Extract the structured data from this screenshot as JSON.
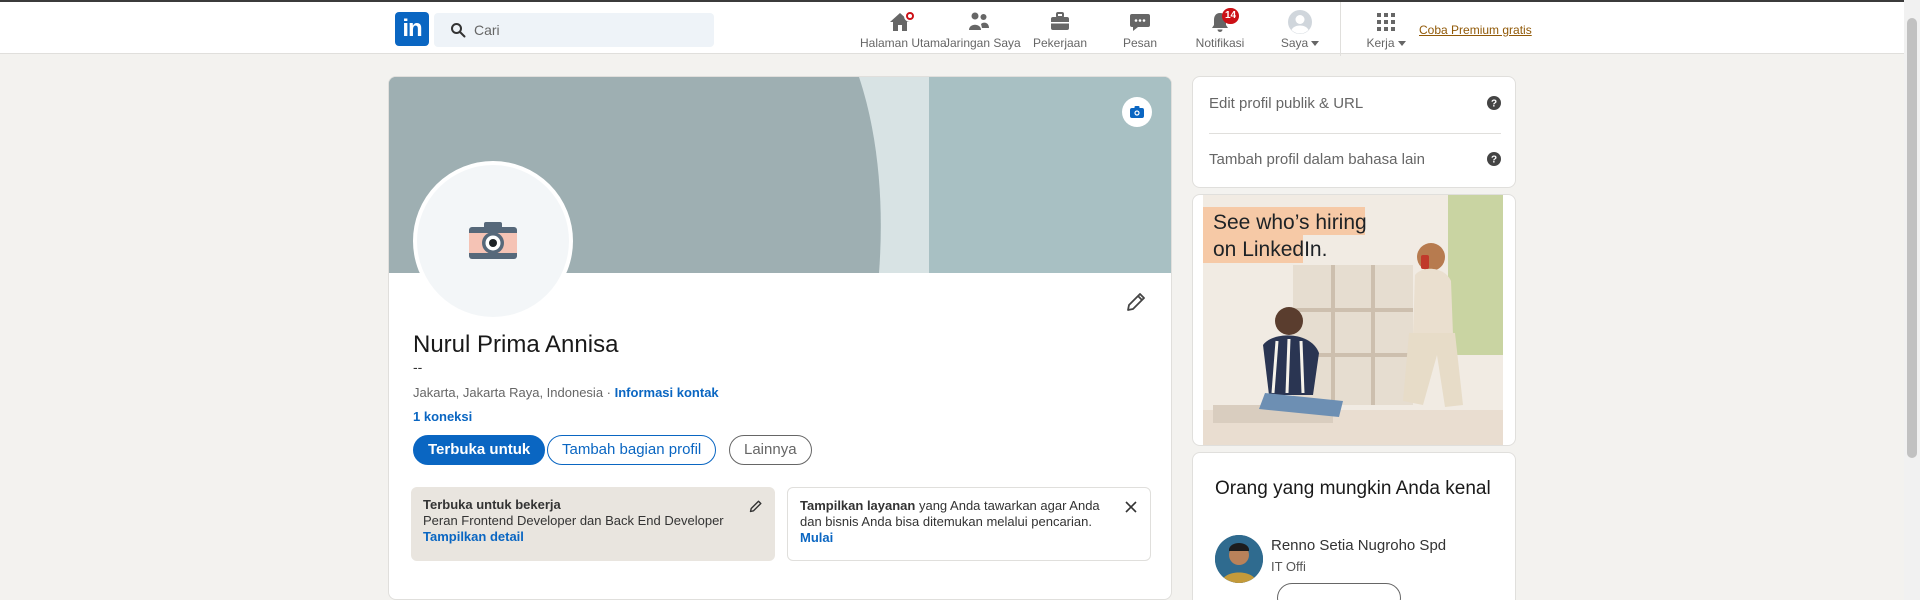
{
  "nav": {
    "logo_text": "in",
    "search_placeholder": "Cari",
    "items": [
      {
        "label": "Halaman Utama",
        "icon": "home-icon"
      },
      {
        "label": "Jaringan Saya",
        "icon": "network-icon"
      },
      {
        "label": "Pekerjaan",
        "icon": "briefcase-icon"
      },
      {
        "label": "Pesan",
        "icon": "messaging-icon"
      },
      {
        "label": "Notifikasi",
        "icon": "bell-icon",
        "badge": "14"
      },
      {
        "label": "Saya",
        "icon": "avatar-icon"
      },
      {
        "label": "Kerja",
        "icon": "grid-icon"
      }
    ],
    "premium_link": "Coba Premium gratis"
  },
  "profile": {
    "name": "Nurul Prima Annisa",
    "headline": "--",
    "location": "Jakarta, Jakarta Raya, Indonesia",
    "separator": " · ",
    "contact_link": "Informasi kontak",
    "connections": "1 koneksi",
    "buttons": {
      "open_to": "Terbuka untuk",
      "add_section": "Tambah bagian profil",
      "more": "Lainnya"
    },
    "open_to_work": {
      "title": "Terbuka untuk bekerja",
      "roles": "Peran Frontend Developer dan Back End Developer",
      "link": "Tampilkan detail"
    },
    "services": {
      "bold": "Tampilkan layanan",
      "text": " yang Anda tawarkan agar Anda dan bisnis Anda bisa ditemukan melalui pencarian.",
      "link": "Mulai"
    }
  },
  "rail": {
    "links": [
      "Edit profil publik & URL",
      "Tambah profil dalam bahasa lain"
    ],
    "ad": {
      "line1": "See who’s hiring",
      "line2": "on LinkedIn."
    },
    "people": {
      "title": "Orang yang mungkin Anda kenal",
      "person_name": "Renno Setia Nugroho Spd",
      "person_title": "IT Offi"
    }
  },
  "colors": {
    "brand": "#0a66c2",
    "badge": "#cc1016",
    "premium": "#915907",
    "cover": "#a0b4b7"
  }
}
